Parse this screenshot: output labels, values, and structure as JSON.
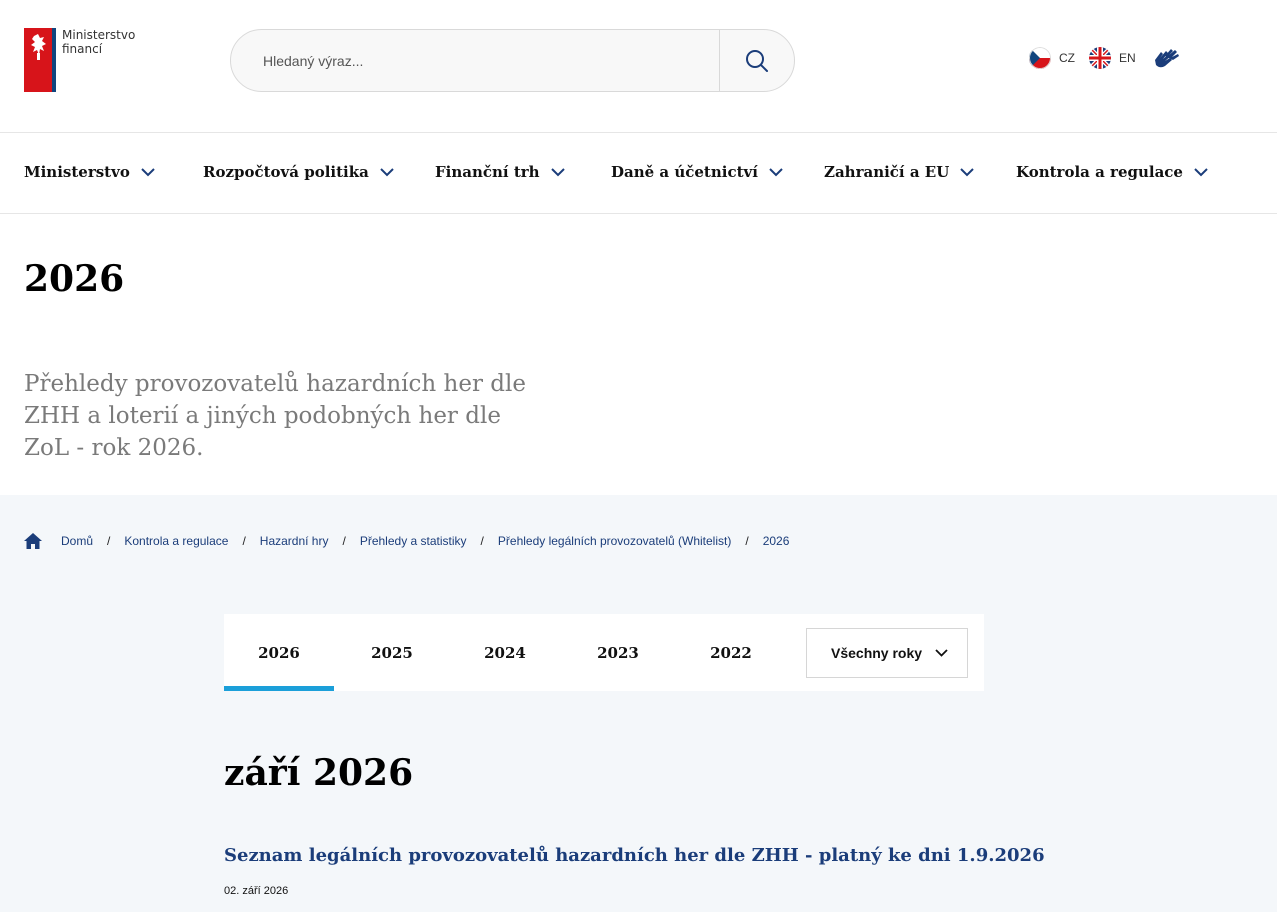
{
  "header": {
    "logo_line1": "Ministerstvo",
    "logo_line2": "financí",
    "search_placeholder": "Hledaný výraz...",
    "lang_cz": "CZ",
    "lang_en": "EN"
  },
  "nav": {
    "items": [
      {
        "label": "Ministerstvo"
      },
      {
        "label": "Rozpočtová politika"
      },
      {
        "label": "Finanční trh"
      },
      {
        "label": "Daně a účetnictví"
      },
      {
        "label": "Zahraničí a EU"
      },
      {
        "label": "Kontrola a regulace"
      }
    ]
  },
  "page": {
    "title": "2026",
    "perex": "Přehledy provozovatelů hazardních her dle ZHH a loterií a jiných podobných her dle ZoL - rok 2026."
  },
  "breadcrumb": {
    "items": [
      {
        "label": "Domů"
      },
      {
        "label": "Kontrola a regulace"
      },
      {
        "label": "Hazardní hry"
      },
      {
        "label": "Přehledy a statistiky"
      },
      {
        "label": "Přehledy legálních provozovatelů (Whitelist)"
      },
      {
        "label": "2026"
      }
    ]
  },
  "tabs": {
    "items": [
      {
        "label": "2026",
        "active": true
      },
      {
        "label": "2025"
      },
      {
        "label": "2024"
      },
      {
        "label": "2023"
      },
      {
        "label": "2022"
      }
    ],
    "select_label": "Všechny roky"
  },
  "content": {
    "month_title": "září 2026",
    "article_title": "Seznam legálních provozovatelů hazardních her dle ZHH - platný ke dni 1.9.2026",
    "article_date": "02. září 2026"
  },
  "colors": {
    "brand_blue": "#1b3d7a",
    "accent_blue": "#1b9fd9",
    "flag_red": "#d7141a"
  }
}
